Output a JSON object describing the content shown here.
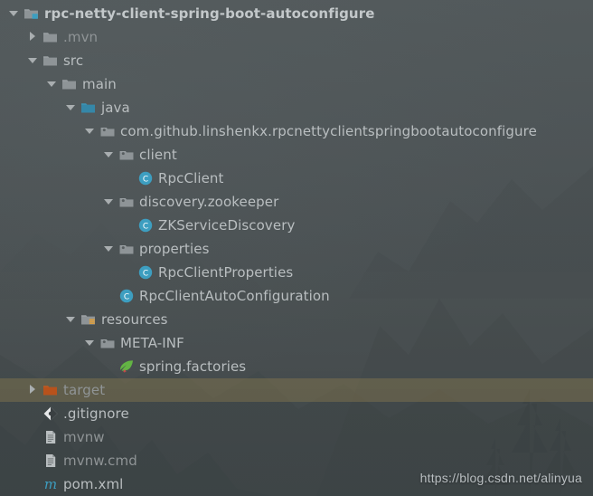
{
  "panel": {
    "background_color": "#4b5153",
    "selected_row_color": "#8c7c4e",
    "text_color": "#b6bbbd"
  },
  "watermark": {
    "text": "https://blog.csdn.net/alinyua"
  },
  "tree": {
    "rows": [
      {
        "label": "rpc-netty-client-spring-boot-autoconfigure",
        "depth": 0,
        "arrow": "expanded",
        "icon": "module-folder-icon",
        "style": "bold"
      },
      {
        "label": ".mvn",
        "depth": 1,
        "arrow": "collapsed",
        "icon": "folder-icon",
        "style": "dim"
      },
      {
        "label": "src",
        "depth": 1,
        "arrow": "expanded",
        "icon": "folder-icon",
        "style": "plain"
      },
      {
        "label": "main",
        "depth": 2,
        "arrow": "expanded",
        "icon": "folder-icon",
        "style": "plain"
      },
      {
        "label": "java",
        "depth": 3,
        "arrow": "expanded",
        "icon": "source-root-folder-icon",
        "style": "plain"
      },
      {
        "label": "com.github.linshenkx.rpcnettyclientspringbootautoconfigure",
        "depth": 4,
        "arrow": "expanded",
        "icon": "package-icon",
        "style": "plain"
      },
      {
        "label": "client",
        "depth": 5,
        "arrow": "expanded",
        "icon": "package-icon",
        "style": "plain"
      },
      {
        "label": "RpcClient",
        "depth": 6,
        "arrow": "none",
        "icon": "java-class-icon",
        "style": "plain"
      },
      {
        "label": "discovery.zookeeper",
        "depth": 5,
        "arrow": "expanded",
        "icon": "package-icon",
        "style": "plain"
      },
      {
        "label": "ZKServiceDiscovery",
        "depth": 6,
        "arrow": "none",
        "icon": "java-class-icon",
        "style": "plain"
      },
      {
        "label": "properties",
        "depth": 5,
        "arrow": "expanded",
        "icon": "package-icon",
        "style": "plain"
      },
      {
        "label": "RpcClientProperties",
        "depth": 6,
        "arrow": "none",
        "icon": "java-class-icon",
        "style": "plain"
      },
      {
        "label": "RpcClientAutoConfiguration",
        "depth": 5,
        "arrow": "none",
        "icon": "java-class-icon",
        "style": "plain"
      },
      {
        "label": "resources",
        "depth": 3,
        "arrow": "expanded",
        "icon": "resources-folder-icon",
        "style": "plain"
      },
      {
        "label": "META-INF",
        "depth": 4,
        "arrow": "expanded",
        "icon": "package-icon",
        "style": "plain"
      },
      {
        "label": "spring.factories",
        "depth": 5,
        "arrow": "none",
        "icon": "spring-leaf-icon",
        "style": "plain"
      },
      {
        "label": "target",
        "depth": 1,
        "arrow": "collapsed",
        "icon": "excluded-folder-icon",
        "style": "dim",
        "selected": true
      },
      {
        "label": ".gitignore",
        "depth": 1,
        "arrow": "none",
        "icon": "git-icon",
        "style": "plain"
      },
      {
        "label": "mvnw",
        "depth": 1,
        "arrow": "none",
        "icon": "ignored-file-icon",
        "style": "dim"
      },
      {
        "label": "mvnw.cmd",
        "depth": 1,
        "arrow": "none",
        "icon": "ignored-file-icon",
        "style": "dim"
      },
      {
        "label": "pom.xml",
        "depth": 1,
        "arrow": "none",
        "icon": "maven-icon",
        "style": "plain"
      }
    ]
  }
}
